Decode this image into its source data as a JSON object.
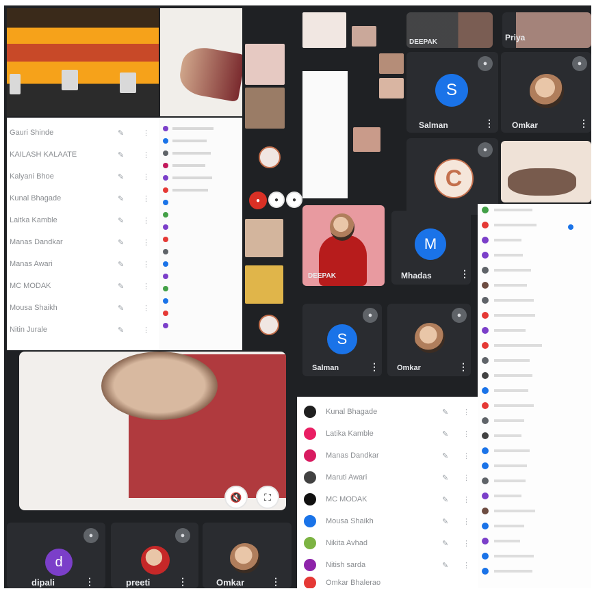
{
  "colors": {
    "background": "#1f2124",
    "tile": "#2b2d31",
    "avatar_blue": "#1a73e8",
    "avatar_purple": "#7b3fc9",
    "banner_orange": "#f39c12",
    "tile_text": "#e8eaed"
  },
  "tiles": {
    "salman_top": {
      "initial": "S",
      "name": "Salman"
    },
    "omkar_top": {
      "name": "Omkar"
    },
    "deepak_top": {
      "name": "DEEPAK"
    },
    "priya_top": {
      "name": "Priya"
    },
    "c_tile": {
      "initial": "C"
    },
    "mhadas": {
      "initial": "M",
      "name": "Mhadas"
    },
    "deepak_mid": {
      "name": "DEEPAK"
    },
    "salman_mid": {
      "initial": "S",
      "name": "Salman"
    },
    "omkar_mid": {
      "name": "Omkar"
    },
    "dipali": {
      "initial": "d",
      "name": "dipali"
    },
    "preeti": {
      "name": "preeti"
    },
    "omkar_bottom": {
      "name": "Omkar"
    }
  },
  "panel_left": {
    "participants": [
      "Gauri Shinde",
      "KAILASH KALAATE",
      "Kalyani Bhoe",
      "Kunal Bhagade",
      "Laitka Kamble",
      "Manas Dandkar",
      "Manas Awari",
      "MC MODAK",
      "Mousa Shaikh",
      "Nitin Jurale"
    ]
  },
  "panel_bottom": {
    "participants": [
      "Kunal Bhagade",
      "Latika Kamble",
      "Manas Dandkar",
      "Maruti Awari",
      "MC MODAK",
      "Mousa Shaikh",
      "Nikita Avhad",
      "Nitish sarda",
      "Omkar Bhalerao"
    ]
  }
}
